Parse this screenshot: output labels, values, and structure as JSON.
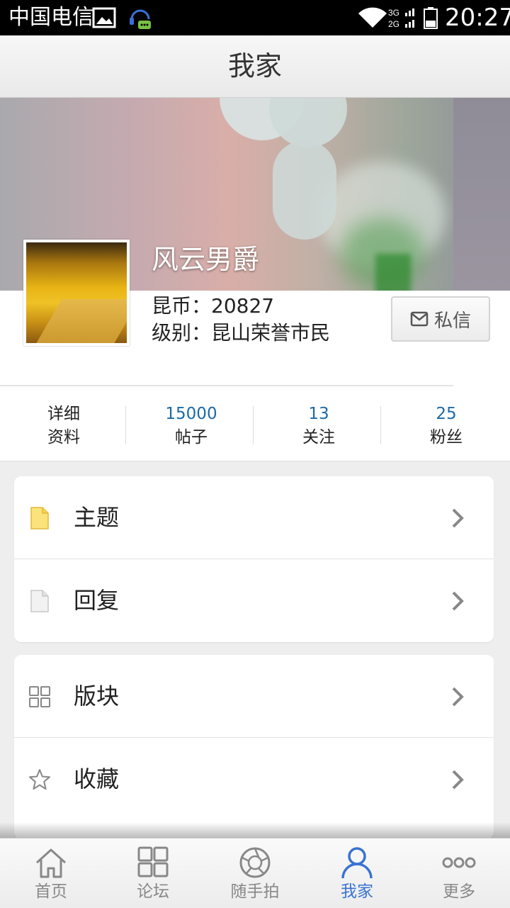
{
  "status_bar": {
    "carrier": "中国电信",
    "time": "20:27",
    "network": [
      "3G",
      "2G"
    ]
  },
  "header": {
    "title": "我家"
  },
  "profile": {
    "username": "风云男爵",
    "coins": "昆币：20827",
    "level": "级别：昆山荣誉市民",
    "message_button": "私信"
  },
  "stats": [
    {
      "value": "",
      "label": "详细\n资料",
      "line1": "详细",
      "line2": "资料"
    },
    {
      "value": "15000",
      "label": "帖子"
    },
    {
      "value": "13",
      "label": "关注"
    },
    {
      "value": "25",
      "label": "粉丝"
    }
  ],
  "menu_group1": [
    {
      "label": "主题",
      "icon": "document-yellow-icon"
    },
    {
      "label": "回复",
      "icon": "document-grey-icon"
    }
  ],
  "menu_group2": [
    {
      "label": "版块",
      "icon": "grid-icon"
    },
    {
      "label": "收藏",
      "icon": "star-icon"
    }
  ],
  "bottom_nav": [
    {
      "label": "首页",
      "icon": "home-icon"
    },
    {
      "label": "论坛",
      "icon": "grid-icon"
    },
    {
      "label": "随手拍",
      "icon": "camera-aperture-icon"
    },
    {
      "label": "我家",
      "icon": "person-icon",
      "active": true
    },
    {
      "label": "更多",
      "icon": "more-dots-icon"
    }
  ],
  "colors": {
    "accent": "#3a73d1",
    "stat_number": "#1c6aa8",
    "background": "#eeeeee"
  }
}
